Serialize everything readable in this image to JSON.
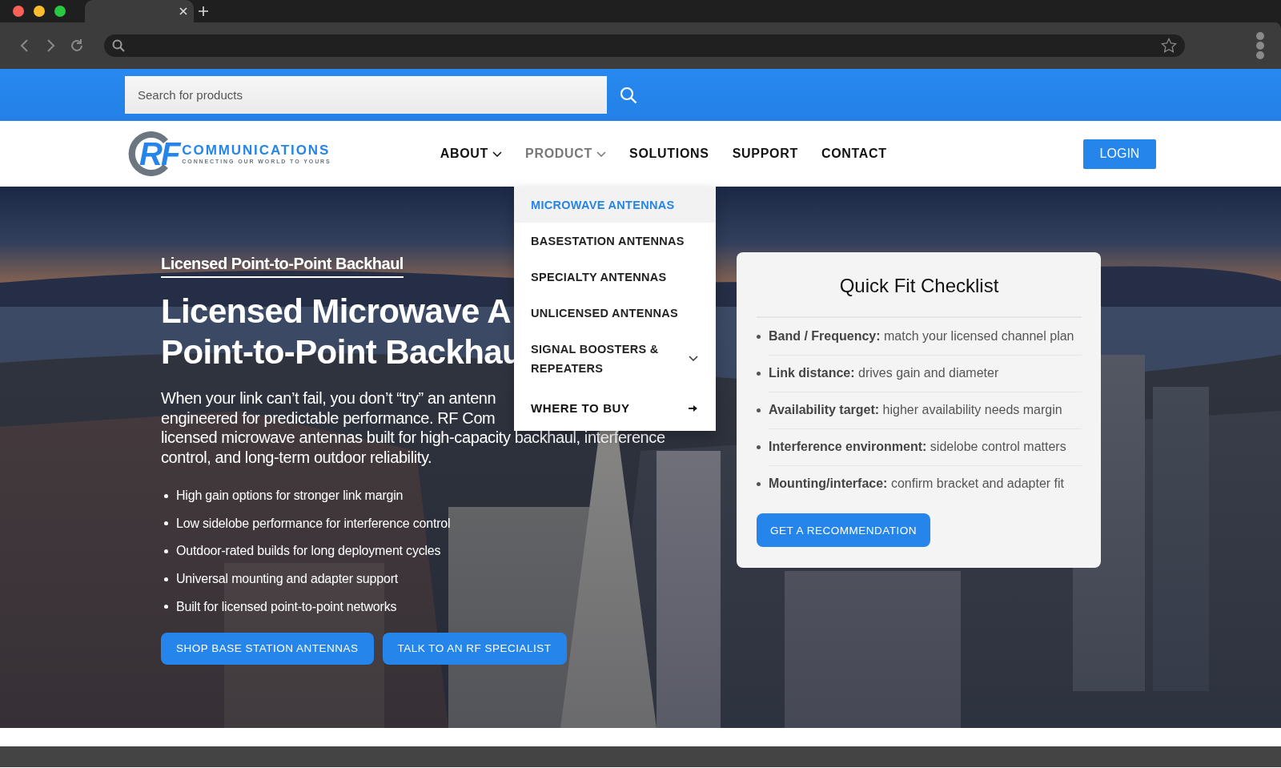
{
  "search": {
    "placeholder": "Search for products"
  },
  "logo": {
    "mark": "RF",
    "name": "COMMUNICATIONS",
    "tagline": "CONNECTING OUR WORLD TO YOURS"
  },
  "nav": {
    "items": [
      {
        "label": "ABOUT",
        "kind": "dropdown",
        "expanded": false
      },
      {
        "label": "PRODUCT",
        "kind": "dropdown",
        "expanded": true
      },
      {
        "label": "SOLUTIONS",
        "kind": "link",
        "expanded": false
      },
      {
        "label": "SUPPORT",
        "kind": "link",
        "expanded": false
      },
      {
        "label": "CONTACT",
        "kind": "link",
        "expanded": false
      }
    ],
    "login": "LOGIN"
  },
  "product_menu": {
    "items": [
      {
        "label": "MICROWAVE ANTENNAS",
        "kind": "link",
        "selected": true
      },
      {
        "label": "BASESTATION ANTENNAS",
        "kind": "link",
        "selected": false
      },
      {
        "label": "SPECIALTY ANTENNAS",
        "kind": "link",
        "selected": false
      },
      {
        "label": "UNLICENSED ANTENNAS",
        "kind": "link",
        "selected": false
      },
      {
        "label": "SIGNAL BOOSTERS & REPEATERS",
        "kind": "submenu",
        "selected": false
      },
      {
        "label": "WHERE TO BUY",
        "kind": "arrow",
        "selected": false
      }
    ]
  },
  "hero": {
    "eyebrow": "Licensed Point-to-Point Backhaul",
    "headline_lines": [
      "Licensed Microwave A",
      "Point-to-Point Backhau"
    ],
    "intro_lines": [
      "When your link can’t fail, you don’t “try” an antenn",
      "engineered for predictable performance. RF Com",
      "licensed microwave antennas built for high-capacity backhaul, interference",
      "control, and long-term outdoor reliability."
    ],
    "bullets": [
      "High gain options for stronger link margin",
      "Low sidelobe performance for interference control",
      "Outdoor-rated builds for long deployment cycles",
      "Universal mounting and adapter support",
      "Built for licensed point-to-point networks"
    ],
    "buttons": [
      "SHOP BASE STATION ANTENNAS",
      "TALK TO AN RF SPECIALIST"
    ]
  },
  "checklist": {
    "title": "Quick Fit Checklist",
    "items": [
      "**Band / Frequency:** match your licensed channel plan",
      "**Link distance:** drives gain and diameter",
      "**Availability target:** higher availability needs margin",
      "**Interference environment:** sidelobe control matters",
      "**Mounting/interface:** confirm bracket and adapter fit"
    ],
    "button": "GET A RECOMMENDATION"
  }
}
